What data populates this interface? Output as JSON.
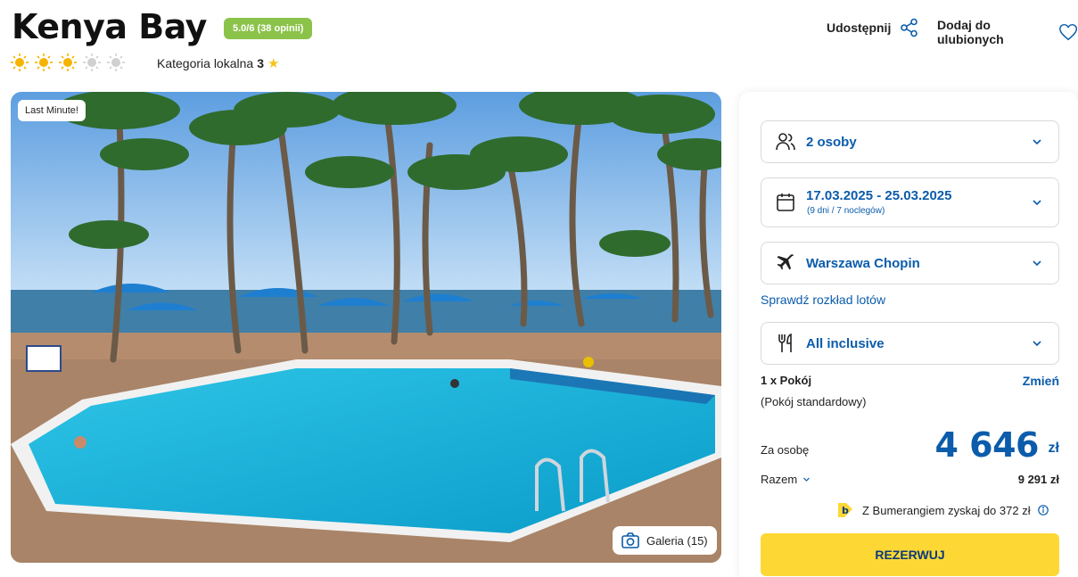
{
  "hotel": {
    "name": "Kenya Bay",
    "rating_badge": "5.0/6 (38 opinii)",
    "stars_filled": 3,
    "stars_total": 5,
    "local_category_label": "Kategoria lokalna",
    "local_category_value": "3"
  },
  "actions": {
    "share_label": "Udostępnij",
    "favorite_label": "Dodaj do ulubionych"
  },
  "photo": {
    "badge": "Last Minute!",
    "gallery_label": "Galeria (15)"
  },
  "booking": {
    "persons": "2 osoby",
    "dates": "17.03.2025 - 25.03.2025",
    "dates_sub": "(9 dni / 7 noclegów)",
    "departure": "Warszawa Chopin",
    "flight_schedule_link": "Sprawdź rozkład lotów",
    "board": "All inclusive",
    "room_count": "1 x Pokój",
    "room_change": "Zmień",
    "room_type": "(Pokój standardowy)",
    "per_person_label": "Za osobę",
    "price_per_person": "4 646",
    "currency": "zł",
    "total_label": "Razem",
    "total_value": "9 291 zł",
    "bumerang_text": "Z Bumerangiem zyskaj do 372 zł",
    "reserve_button": "REZERWUJ"
  },
  "colors": {
    "primary": "#0b5cab",
    "rating_badge": "#8bc34a",
    "reserve_button": "#fdd835",
    "star_active": "#f5b400",
    "star_inactive": "#d0d0d0"
  }
}
